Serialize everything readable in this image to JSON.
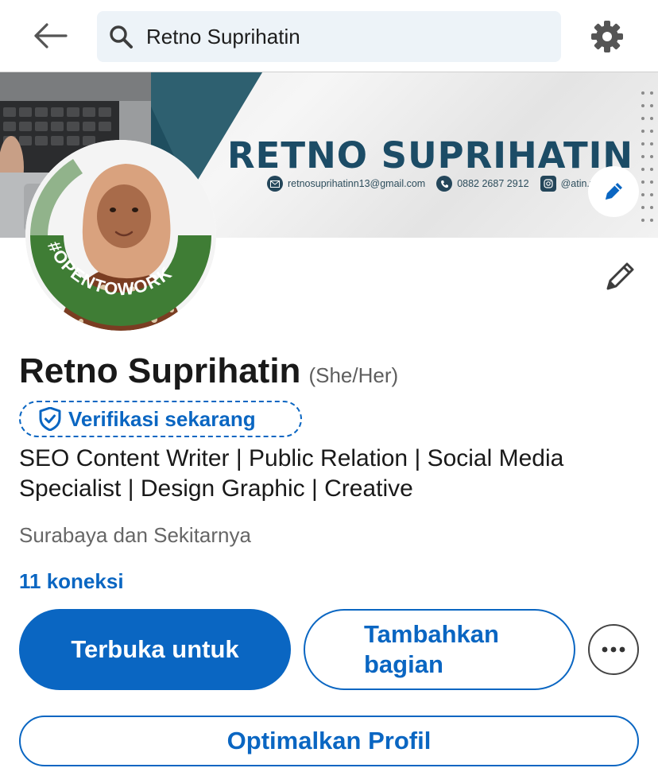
{
  "search": {
    "query": "Retno Suprihatin"
  },
  "banner": {
    "name": "RETNO SUPRIHATIN",
    "email": "retnosuprihatinn13@gmail.com",
    "phone": "0882 2687 2912",
    "instagram": "@atin.vv"
  },
  "avatar": {
    "frame_text": "#OPENTOWORK"
  },
  "profile": {
    "name": "Retno Suprihatin",
    "pronouns": "(She/Her)",
    "verify_label": "Verifikasi sekarang",
    "headline": "SEO Content Writer | Public Relation | Social Media Specialist | Design Graphic | Creative",
    "location": "Surabaya dan Sekitarnya",
    "connections": "11 koneksi"
  },
  "actions": {
    "open_to": "Terbuka untuk",
    "add_section_line1": "Tambahkan",
    "add_section_line2": "bagian",
    "optimize": "Optimalkan Profil"
  },
  "icons": {
    "back": "arrow-left-icon",
    "search": "search-icon",
    "settings": "gear-icon",
    "edit": "pencil-icon",
    "verify": "shield-check-icon",
    "more": "ellipsis-icon"
  },
  "colors": {
    "accent": "#0a66c2",
    "open_to_work_green": "#3f7d35",
    "banner_name": "#1c4c66",
    "banner_dark": "#1f4e5f"
  }
}
